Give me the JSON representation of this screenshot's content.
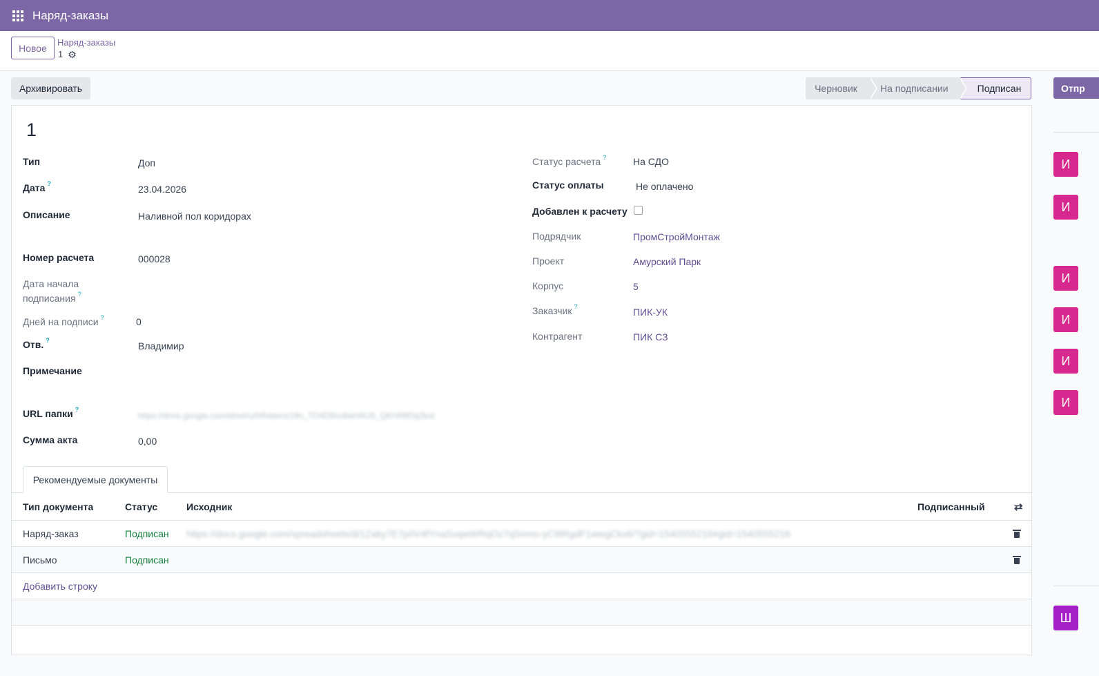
{
  "app": {
    "title": "Наряд-заказы"
  },
  "control": {
    "new_label": "Новое",
    "breadcrumb_parent": "Наряд-заказы",
    "breadcrumb_current": "1"
  },
  "status": {
    "archive_label": "Архивировать",
    "stages": [
      "Черновик",
      "На подписании",
      "Подписан"
    ],
    "active_stage": "Подписан",
    "send_label": "Отпр"
  },
  "record": {
    "name": "1",
    "left": {
      "type_label": "Тип",
      "type_value": "Доп",
      "date_label": "Дата",
      "date_value": "23.04.2026",
      "desc_label": "Описание",
      "desc_value": "Наливной пол коридорах",
      "calc_no_label": "Номер расчета",
      "calc_no_value": "000028",
      "sign_start_label_1": "Дата начала",
      "sign_start_label_2": "подписания",
      "days_label": "Дней на подписи",
      "days_value": "0",
      "resp_label": "Отв.",
      "resp_value": "Владимир",
      "note_label": "Примечание",
      "url_label": "URL папки",
      "url_value": "https://drive.google.com/drive/u/0/folders/19n_TO4D9sv8wHAU5_QKHIWDq2kot",
      "sum_label": "Сумма акта",
      "sum_value": "0,00"
    },
    "right": {
      "calc_status_label": "Статус расчета",
      "calc_status_value": "На СДО",
      "pay_status_label": "Статус оплаты",
      "pay_status_value": "Не оплачено",
      "added_label": "Добавлен к расчету",
      "added_value": false,
      "contractor_label": "Подрядчик",
      "contractor_value": "ПромСтройМонтаж",
      "project_label": "Проект",
      "project_value": "Амурский Парк",
      "building_label": "Корпус",
      "building_value": "5",
      "customer_label": "Заказчик",
      "customer_value": "ПИК-УК",
      "counterparty_label": "Контрагент",
      "counterparty_value": "ПИК СЗ"
    }
  },
  "tab": {
    "label": "Рекомендуемые документы"
  },
  "table": {
    "headers": {
      "type": "Тип документа",
      "status": "Статус",
      "source": "Исходник",
      "signed": "Подписанный"
    },
    "rows": [
      {
        "type": "Наряд-заказ",
        "status": "Подписан",
        "source": "https://docs.google.com/spreadsheets/d/1Zaky7E7p0V4fYnaSvqwWRqOz7qSnmo-yC9lRgdF1wwgCkx6/?gid=1540555216#gid=1540555216"
      },
      {
        "type": "Письмо",
        "status": "Подписан",
        "source": ""
      }
    ],
    "add_line": "Добавить строку"
  },
  "chatter": {
    "avatars": [
      "И",
      "И",
      "И",
      "И",
      "И",
      "И",
      "Ш"
    ]
  },
  "colors": {
    "brand": "#7c66a6",
    "success": "#15803d",
    "avatar_pink": "#d6288f",
    "avatar_purple": "#a51fc9"
  }
}
